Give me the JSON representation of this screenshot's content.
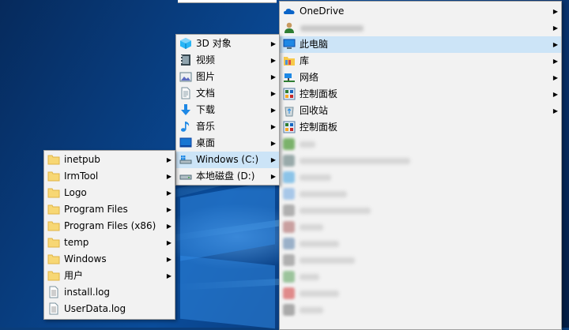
{
  "menu1": {
    "items": [
      {
        "label": "OneDrive",
        "icon": "onedrive-cloud-icon",
        "has_submenu": true
      },
      {
        "label": "",
        "icon": "user-avatar-icon",
        "has_submenu": true
      },
      {
        "label": "此电脑",
        "icon": "this-pc-icon",
        "has_submenu": true,
        "highlighted": true
      },
      {
        "label": "库",
        "icon": "library-folder-icon",
        "has_submenu": true
      },
      {
        "label": "网络",
        "icon": "network-icon",
        "has_submenu": true
      },
      {
        "label": "控制面板",
        "icon": "control-panel-icon",
        "has_submenu": true
      },
      {
        "label": "回收站",
        "icon": "recycle-bin-icon",
        "has_submenu": true
      },
      {
        "label": "控制面板",
        "icon": "control-panel-icon",
        "has_submenu": false
      }
    ]
  },
  "menu2": {
    "items": [
      {
        "label": "3D 对象",
        "icon": "3d-objects-icon",
        "has_submenu": true
      },
      {
        "label": "视频",
        "icon": "videos-icon",
        "has_submenu": true
      },
      {
        "label": "图片",
        "icon": "pictures-icon",
        "has_submenu": true
      },
      {
        "label": "文档",
        "icon": "documents-icon",
        "has_submenu": true
      },
      {
        "label": "下载",
        "icon": "downloads-icon",
        "has_submenu": true
      },
      {
        "label": "音乐",
        "icon": "music-icon",
        "has_submenu": true
      },
      {
        "label": "桌面",
        "icon": "desktop-icon",
        "has_submenu": true
      },
      {
        "label": "Windows (C:)",
        "icon": "drive-c-icon",
        "has_submenu": true,
        "highlighted": true
      },
      {
        "label": "本地磁盘 (D:)",
        "icon": "drive-d-icon",
        "has_submenu": true
      }
    ]
  },
  "menu3": {
    "items": [
      {
        "label": "inetpub",
        "icon": "folder-icon",
        "has_submenu": true
      },
      {
        "label": "IrmTool",
        "icon": "folder-icon",
        "has_submenu": true
      },
      {
        "label": "Logo",
        "icon": "folder-icon",
        "has_submenu": true
      },
      {
        "label": "Program Files",
        "icon": "folder-icon",
        "has_submenu": true
      },
      {
        "label": "Program Files (x86)",
        "icon": "folder-icon",
        "has_submenu": true
      },
      {
        "label": "temp",
        "icon": "folder-icon",
        "has_submenu": true
      },
      {
        "label": "Windows",
        "icon": "folder-icon",
        "has_submenu": true
      },
      {
        "label": "用户",
        "icon": "folder-icon",
        "has_submenu": true
      },
      {
        "label": "install.log",
        "icon": "text-file-icon",
        "has_submenu": false
      },
      {
        "label": "UserData.log",
        "icon": "text-file-icon",
        "has_submenu": false
      }
    ]
  },
  "arrow_glyph": "▶",
  "colors": {
    "highlight": "#cce4f7",
    "menu_bg": "#f2f2f2",
    "folder": "#f7d774"
  }
}
